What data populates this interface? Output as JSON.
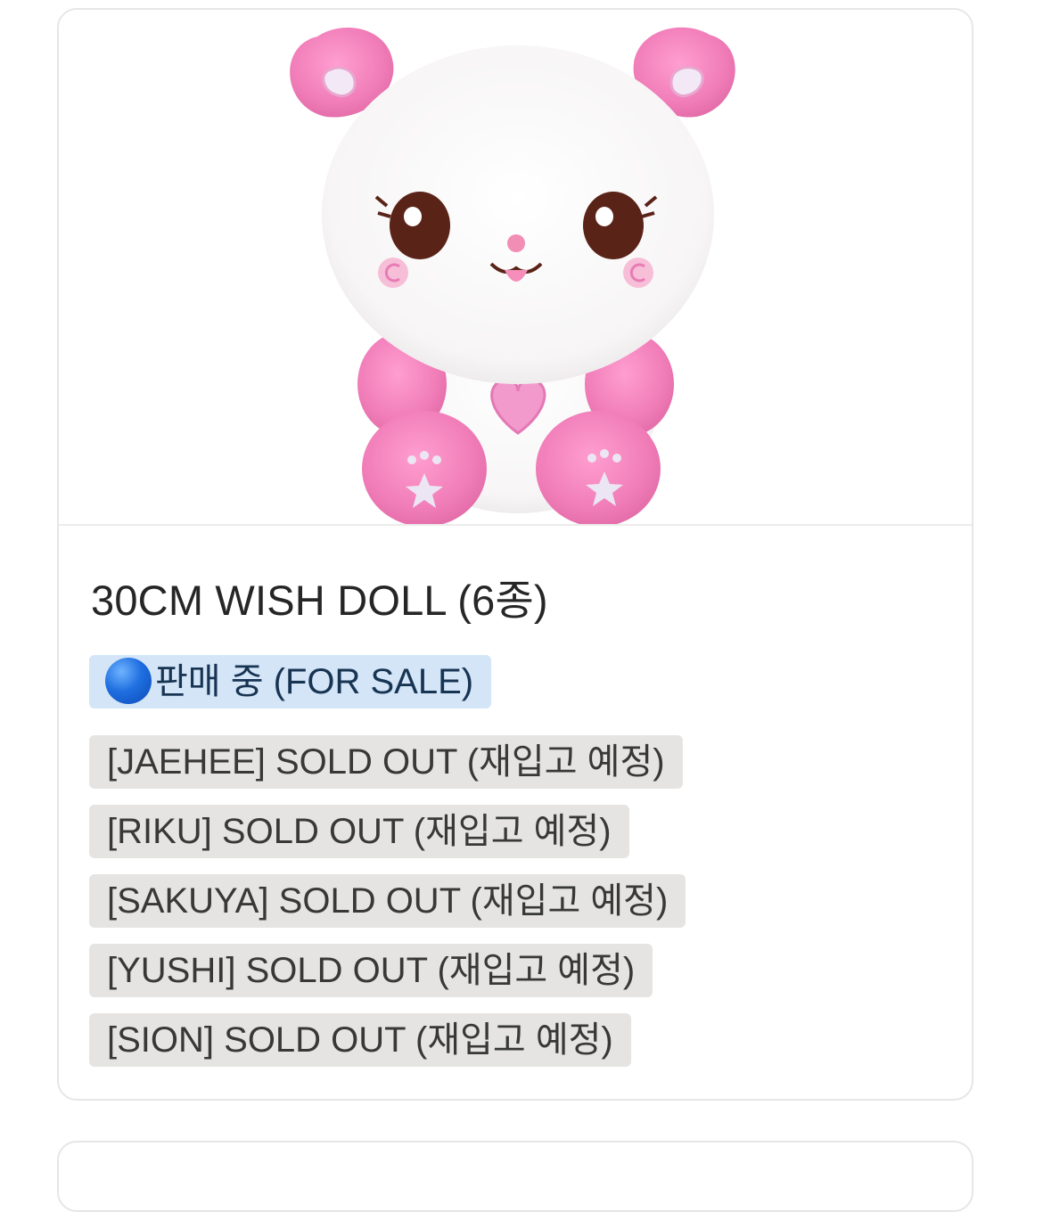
{
  "product": {
    "title": "30CM WISH DOLL (6종)",
    "image_icon": "pink-white-bear-plush-image",
    "status": {
      "icon": "blue-circle-icon",
      "label": "판매 중 (FOR SALE)",
      "color": "#d3e5f7"
    },
    "variants": [
      {
        "label": "[JAEHEE] SOLD OUT (재입고 예정)"
      },
      {
        "label": "[RIKU] SOLD OUT (재입고 예정)"
      },
      {
        "label": "[SAKUYA] SOLD OUT (재입고 예정)"
      },
      {
        "label": "[YUSHI] SOLD OUT (재입고 예정)"
      },
      {
        "label": "[SION] SOLD OUT (재입고 예정)"
      }
    ],
    "sold_out_color": "#e5e4e2"
  }
}
